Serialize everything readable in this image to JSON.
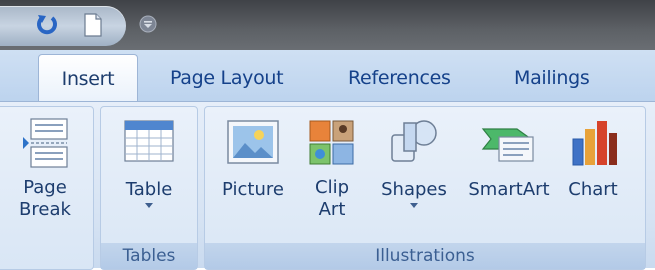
{
  "quick_access": {
    "icons": [
      "undo-icon",
      "new-document-icon",
      "customize-dropdown-icon"
    ]
  },
  "tabs": [
    {
      "label": "Insert",
      "active": true
    },
    {
      "label": "Page Layout",
      "active": false
    },
    {
      "label": "References",
      "active": false
    },
    {
      "label": "Mailings",
      "active": false
    }
  ],
  "groups": {
    "pages": {
      "page_break": {
        "label_line1": "Page",
        "label_line2": "Break",
        "icon": "page-break-icon"
      }
    },
    "tables": {
      "label": "Tables",
      "table": {
        "label": "Table",
        "icon": "table-icon"
      }
    },
    "illustrations": {
      "label": "Illustrations",
      "picture": {
        "label": "Picture",
        "icon": "picture-icon"
      },
      "clip_art": {
        "label_line1": "Clip",
        "label_line2": "Art",
        "icon": "clip-art-icon"
      },
      "shapes": {
        "label": "Shapes",
        "icon": "shapes-icon"
      },
      "smartart": {
        "label": "SmartArt",
        "icon": "smartart-icon"
      },
      "chart": {
        "label": "Chart",
        "icon": "chart-icon"
      }
    }
  },
  "colors": {
    "tab_text": "#15418a",
    "label_text": "#1d3d6e",
    "group_label_text": "#3b5f92",
    "ribbon_bg": "#dbe6f4"
  }
}
